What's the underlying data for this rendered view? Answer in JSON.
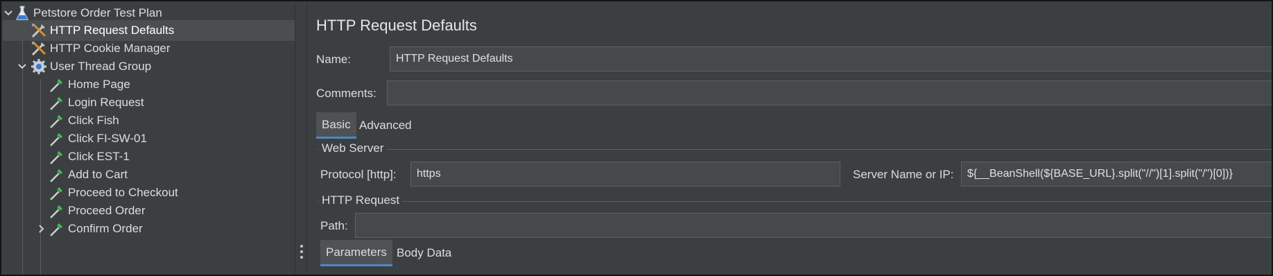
{
  "tree": {
    "root": {
      "label": "Petstore Order Test Plan",
      "icon": "flask-icon"
    },
    "items": [
      {
        "label": "HTTP Request Defaults",
        "icon": "wrench-screwdriver-icon",
        "selected": true
      },
      {
        "label": "HTTP Cookie Manager",
        "icon": "wrench-screwdriver-icon"
      },
      {
        "label": "User Thread Group",
        "icon": "gear-icon",
        "expanded": true
      },
      {
        "label": "Home Page",
        "icon": "pipette-icon"
      },
      {
        "label": "Login Request",
        "icon": "pipette-icon"
      },
      {
        "label": "Click Fish",
        "icon": "pipette-icon"
      },
      {
        "label": "Click FI-SW-01",
        "icon": "pipette-icon"
      },
      {
        "label": "Click EST-1",
        "icon": "pipette-icon"
      },
      {
        "label": "Add to Cart",
        "icon": "pipette-icon"
      },
      {
        "label": "Proceed to Checkout",
        "icon": "pipette-icon"
      },
      {
        "label": "Proceed Order",
        "icon": "pipette-icon"
      },
      {
        "label": "Confirm Order",
        "icon": "pipette-icon",
        "collapsed": true
      }
    ]
  },
  "panel": {
    "title": "HTTP Request Defaults",
    "name_label": "Name:",
    "name_value": "HTTP Request Defaults",
    "comments_label": "Comments:",
    "comments_value": "",
    "tabs": [
      {
        "label": "Basic",
        "active": true
      },
      {
        "label": "Advanced"
      }
    ],
    "web_server": {
      "title": "Web Server",
      "protocol_label": "Protocol [http]:",
      "protocol_value": "https",
      "server_label": "Server Name or IP:",
      "server_value": "${__BeanShell(${BASE_URL}.split(\"//\")[1].split(\"/\")[0])}"
    },
    "http_request": {
      "title": "HTTP Request",
      "path_label": "Path:",
      "path_value": ""
    },
    "sub_tabs": [
      {
        "label": "Parameters",
        "active": true
      },
      {
        "label": "Body Data"
      }
    ]
  },
  "colors": {
    "background": "#3c3f41",
    "selection": "#4b4e50",
    "tab_accent": "#4a88c7",
    "field_bg": "#45494a"
  }
}
